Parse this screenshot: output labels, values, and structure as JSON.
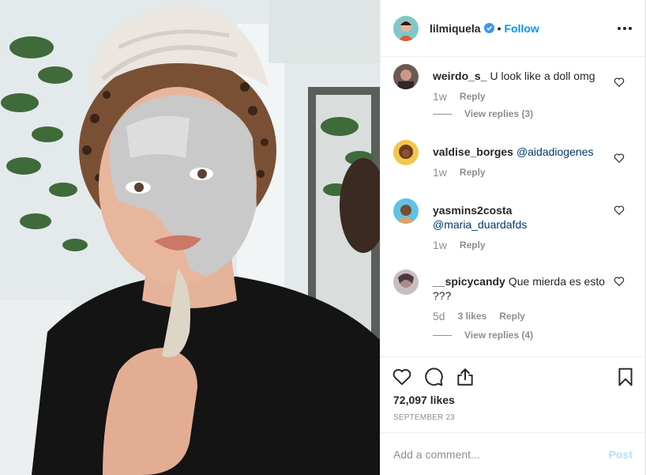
{
  "post": {
    "image_alt": "lilmiquela selfie with towel and face mask",
    "author": {
      "username": "lilmiquela",
      "verified": true,
      "separator": "•",
      "follow_label": "Follow"
    },
    "more_icon": "more-options-icon",
    "comments": [
      {
        "username": "weirdo_s_",
        "text": "U look like a doll omg",
        "mention": "",
        "time": "1w",
        "likes": "",
        "reply_label": "Reply",
        "view_replies": "View replies (3)"
      },
      {
        "username": "valdise_borges",
        "text": "",
        "mention": "@aidadiogenes",
        "time": "1w",
        "likes": "",
        "reply_label": "Reply",
        "view_replies": ""
      },
      {
        "username": "yasmins2costa",
        "text": "",
        "mention": "@maria_duardafds",
        "time": "1w",
        "likes": "",
        "reply_label": "Reply",
        "view_replies": ""
      },
      {
        "username": "__spicycandy",
        "text": "Que mierda es esto ???",
        "mention": "",
        "time": "5d",
        "likes": "3 likes",
        "reply_label": "Reply",
        "view_replies": "View replies (4)"
      }
    ],
    "actions": {
      "like_icon": "heart-icon",
      "comment_icon": "comment-icon",
      "share_icon": "share-icon",
      "save_icon": "bookmark-icon"
    },
    "likes_count": "72,097 likes",
    "date": "SEPTEMBER 23",
    "add_comment": {
      "placeholder": "Add a comment...",
      "post_label": "Post"
    }
  },
  "colors": {
    "accent": "#0095f6",
    "mention": "#00376b",
    "muted": "#8e8e8e",
    "post_disabled": "#b2dffc"
  }
}
